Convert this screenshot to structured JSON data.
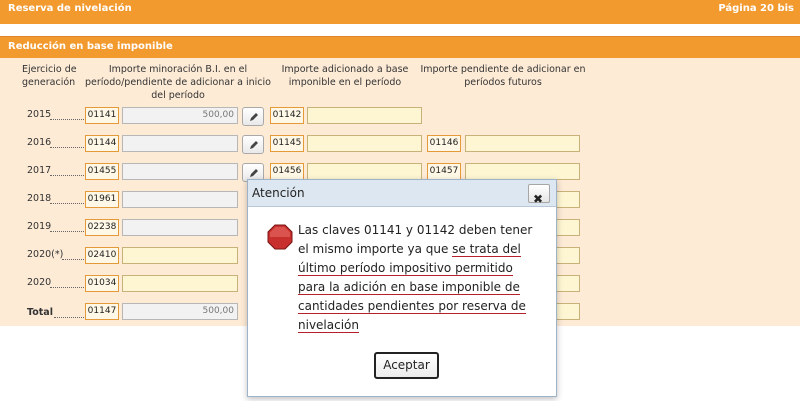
{
  "header": {
    "title": "Reserva de nivelación",
    "page": "Página 20 bis"
  },
  "section": {
    "title": "Reducción en base imponible"
  },
  "columns": {
    "year": [
      "Ejercicio de",
      "generación"
    ],
    "reduction": [
      "Importe minoración B.I. en el",
      "período/pendiente de adicionar a inicio",
      "del período"
    ],
    "added": [
      "Importe adicionado a base",
      "imponible en el período"
    ],
    "pending": [
      "Importe pendiente de adicionar en",
      "períodos futuros"
    ]
  },
  "rows": [
    {
      "year": "2015",
      "code1": "01141",
      "value1": "500,00",
      "code2": "01142",
      "value2": "",
      "code3": "",
      "value3": ""
    },
    {
      "year": "2016",
      "code1": "01144",
      "value1": "",
      "code2": "01145",
      "value2": "",
      "code3": "01146",
      "value3": ""
    },
    {
      "year": "2017",
      "code1": "01455",
      "value1": "",
      "code2": "01456",
      "value2": "",
      "code3": "01457",
      "value3": ""
    },
    {
      "year": "2018",
      "code1": "01961",
      "value1": "",
      "code2": "",
      "value2": "",
      "code3": "",
      "value3": ""
    },
    {
      "year": "2019",
      "code1": "02238",
      "value1": "",
      "code2": "",
      "value2": "",
      "code3": "",
      "value3": ""
    },
    {
      "year": "2020(*)",
      "code1": "02410",
      "value1": "",
      "code2": "",
      "value2": "",
      "code3": "",
      "value3": ""
    },
    {
      "year": "2020",
      "code1": "01034",
      "value1": "",
      "code2": "",
      "value2": "",
      "code3": "",
      "value3": ""
    }
  ],
  "total": {
    "label": "Total",
    "code": "01147",
    "value": "500,00"
  },
  "dialog": {
    "title": "Atención",
    "close": "✖",
    "message_plain": "Las claves 01141 y 01142 deben tener el mismo importe ya que ",
    "message_underlined": "se trata del último período impositivo permitido para la adición en base imponible de cantidades pendientes por reserva de nivelación",
    "ok": "Aceptar"
  },
  "icons": {
    "edit": "pencil-icon",
    "stop": "stop-icon",
    "close": "close-icon"
  },
  "colors": {
    "accent": "#f39a2f",
    "panel": "#fdebd6",
    "error": "#b7202a"
  }
}
